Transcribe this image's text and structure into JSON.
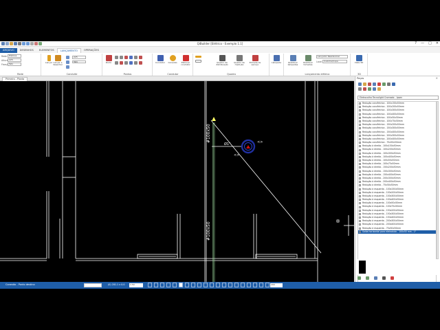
{
  "window": {
    "title": "QiBuilder [Elétrico - Exemplo 1.1]",
    "controls": [
      "?",
      "—",
      "□",
      "✕"
    ]
  },
  "menu": {
    "tabs": [
      "ARQUIVO",
      "DESENHOS",
      "ELEMENTOS",
      "LANÇAMENTO",
      "OPERAÇÕES"
    ],
    "active_index": 3
  },
  "ribbon": {
    "rede": {
      "label": "Rede",
      "fields": [
        {
          "label": "Rede",
          "value": "Elétrica"
        },
        {
          "label": "Altura",
          "value": "225"
        },
        {
          "label": "Fixação",
          "value": "Teto"
        }
      ]
    },
    "conduite": {
      "label": "Conduíte",
      "buttons": [
        "Lançar",
        "Lançar e desenhar"
      ],
      "fields": [
        {
          "label": "",
          "value": "225"
        },
        {
          "label": "",
          "value": "Teto"
        }
      ]
    },
    "pontos": {
      "label": "Pontos",
      "buttons": [
        "Ponto"
      ]
    },
    "condutor": {
      "label": "Condutor",
      "buttons": [
        "Condutor",
        "Conexão",
        "Eliminar condutor"
      ]
    },
    "quadro": {
      "label": "Quadro",
      "buttons": [
        "Quadro de distribuição",
        "Quadro de medição",
        "Entrada de serviço"
      ]
    },
    "lampada": {
      "buttons": [
        "Lâmpada"
      ]
    },
    "lancamento_eletrico": {
      "label": "Lançamento elétrico",
      "buttons": [
        "Distribuir lâmpadas",
        "Distribuir tomadas"
      ],
      "fields": [
        {
          "label": "",
          "value": "Lançador Residencial"
        },
        {
          "label": "Local",
          "value": "Cozinha/Copa"
        }
      ]
    },
    "v3d": {
      "label": "3D",
      "buttons": [
        "Vista 3D"
      ]
    }
  },
  "document": {
    "tab": "Primeiro - Planta"
  },
  "canvas": {
    "annotations": [
      "#100x50",
      "#100x50",
      "Ø1\"",
      "<>",
      "<>"
    ]
  },
  "side_panel": {
    "title": "Peças",
    "close": "×",
    "filter": "Eletrocalha Tecnolight Cromado - Ipsen",
    "items": [
      "Redução concêntrica - 100x150x50mm",
      "Redução concêntrica - 100x200x50mm",
      "Redução concêntrica - 100x300x50mm",
      "Redução concêntrica - 100x400x50mm",
      "Redução concêntrica - 100x50x50mm",
      "Redução concêntrica - 100x75x50mm",
      "Redução concêntrica - 150x200x50mm",
      "Redução concêntrica - 150x300x50mm",
      "Redução concêntrica - 150x400x50mm",
      "Redução concêntrica - 200x300x50mm",
      "Redução concêntrica - 200x400x50mm",
      "Redução concêntrica - 75x50x50mm",
      "Redução à direita - 100x150x50mm",
      "Redução à direita - 100x200x50mm",
      "Redução à direita - 100x300x50mm",
      "Redução à direita - 100x400x50mm",
      "Redução à direita - 100x50x50mm",
      "Redução à direita - 100x75x50mm",
      "Redução à direita - 150x200x50mm",
      "Redução à direita - 150x300x50mm",
      "Redução à direita - 150x400x50mm",
      "Redução à direita - 200x300x50mm",
      "Redução à direita - 200x400x50mm",
      "Redução à direita - 75x50x50mm",
      "Redução à esquerda - 100x150x50mm",
      "Redução à esquerda - 100x200x50mm",
      "Redução à esquerda - 100x300x50mm",
      "Redução à esquerda - 100x400x50mm",
      "Redução à esquerda - 100x50x50mm",
      "Redução à esquerda - 100x75x50mm",
      "Redução à esquerda - 150x200x50mm",
      "Redução à esquerda - 150x300x50mm",
      "Redução à esquerda - 150x400x50mm",
      "Redução à esquerda - 200x300x50mm",
      "Redução à esquerda - 200x400x50mm",
      "Redução à esquerda - 75x50x50mm",
      "Saída horizontal para eletroduto - 100x50 mm - 1\""
    ],
    "selected_index": 36
  },
  "status": {
    "mode": "Conexão - Ponto destino",
    "coords": "(0) 201.1 x 0.0",
    "scale": "1:50",
    "zoom": "200"
  },
  "colors": {
    "accent": "#1f5ea8",
    "canvas": "#000000",
    "drawing_lines": "#ffffff",
    "conduit": "#9ad39a",
    "point_marker": "#1f2fa0",
    "point_fill": "#cc1010"
  }
}
